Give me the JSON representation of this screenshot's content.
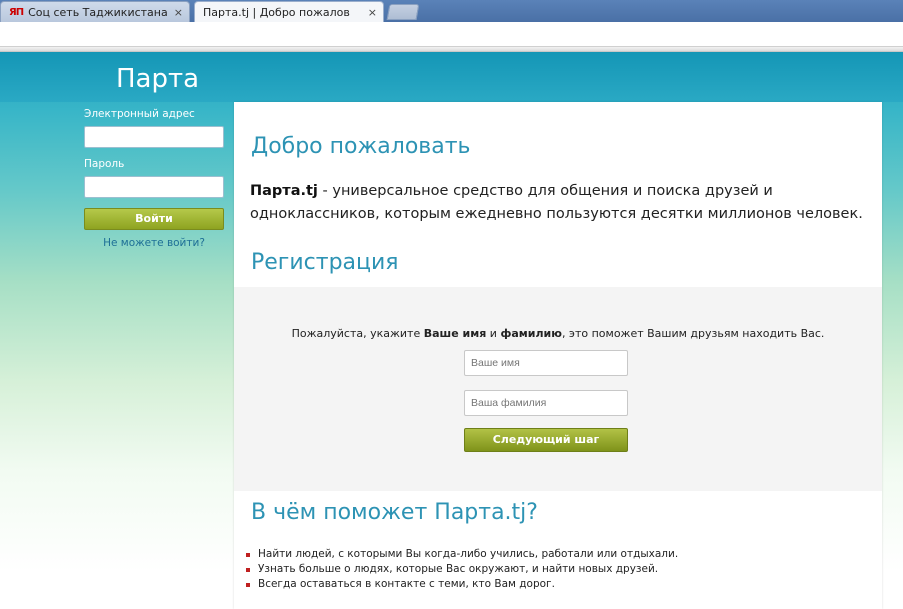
{
  "browser": {
    "tabs": [
      {
        "favicon": "ЯП",
        "title": "Соц сеть Таджикистана -",
        "close": "×",
        "active": false
      },
      {
        "favicon": "page-icon",
        "title": "Парта.tj | Добро пожалов",
        "close": "×",
        "active": true
      }
    ]
  },
  "header": {
    "site_title": "Парта"
  },
  "login": {
    "email_label": "Электронный адрес",
    "email_value": "",
    "password_label": "Пароль",
    "password_value": "",
    "login_button": "Войти",
    "forgot_link": "Не можете войти?"
  },
  "main": {
    "welcome_heading": "Добро пожаловать",
    "intro_brand": "Парта.tj",
    "intro_text": " - универсальное средство для общения и поиска друзей и одноклассников, которым ежедневно пользуются десятки миллионов человек.",
    "registration_heading": "Регистрация",
    "registration": {
      "prompt_start": "Пожалуйста, укажите ",
      "prompt_name": "Ваше имя",
      "prompt_and": " и ",
      "prompt_surname": "фамилию",
      "prompt_end": ", это поможет Вашим друзьям находить Вас.",
      "first_name_placeholder": "Ваше имя",
      "last_name_placeholder": "Ваша фамилия",
      "next_button": "Следующий шаг"
    },
    "help_heading": "В чём поможет Парта.tj?",
    "help_items": [
      "Найти людей, с которыми Вы когда-либо учились, работали или отдыхали.",
      "Узнать больше о людях, которые Вас окружают, и найти новых друзей.",
      "Всегда оставаться в контакте с теми, кто Вам дорог."
    ]
  },
  "colors": {
    "accent_heading": "#2d93b4",
    "header_band": "#1496b6",
    "button_green": "#8ea321",
    "bullet_red": "#c02020"
  }
}
